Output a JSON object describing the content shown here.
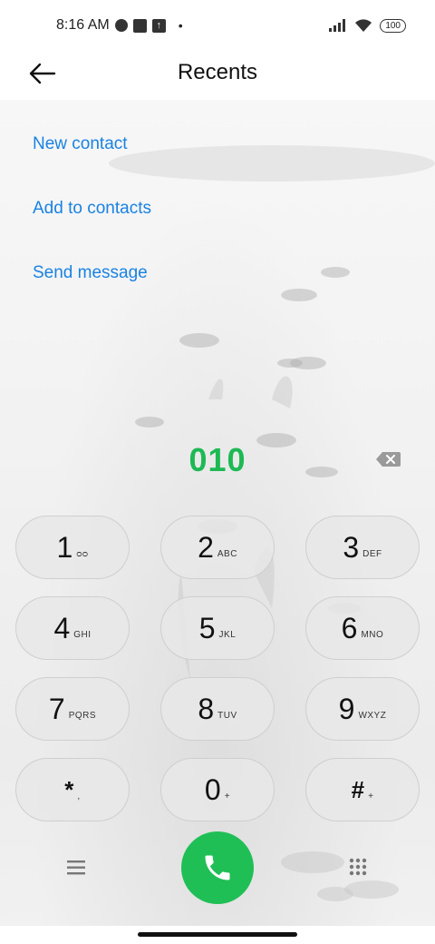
{
  "status_bar": {
    "time": "8:16 AM",
    "battery": "100",
    "icons": [
      "cloud-icon",
      "notification-square-icon",
      "upload-icon",
      "dot-icon",
      "signal-icon",
      "wifi-icon",
      "battery-icon"
    ]
  },
  "header": {
    "title": "Recents",
    "back_icon": "back-arrow-icon"
  },
  "actions": {
    "new_contact": "New contact",
    "add_to_contacts": "Add to contacts",
    "send_message": "Send message"
  },
  "dialer": {
    "number": "010",
    "accent_color": "#1db954",
    "link_color": "#1a82e2",
    "call_color": "#1fbf55"
  },
  "keys": [
    {
      "digit": "1",
      "letters": "ᴑᴑ"
    },
    {
      "digit": "2",
      "letters": "ABC"
    },
    {
      "digit": "3",
      "letters": "DEF"
    },
    {
      "digit": "4",
      "letters": "GHI"
    },
    {
      "digit": "5",
      "letters": "JKL"
    },
    {
      "digit": "6",
      "letters": "MNO"
    },
    {
      "digit": "7",
      "letters": "PQRS"
    },
    {
      "digit": "8",
      "letters": "TUV"
    },
    {
      "digit": "9",
      "letters": "WXYZ"
    },
    {
      "digit": "*",
      "letters": ","
    },
    {
      "digit": "0",
      "letters": "+"
    },
    {
      "digit": "#",
      "letters": "+"
    }
  ]
}
